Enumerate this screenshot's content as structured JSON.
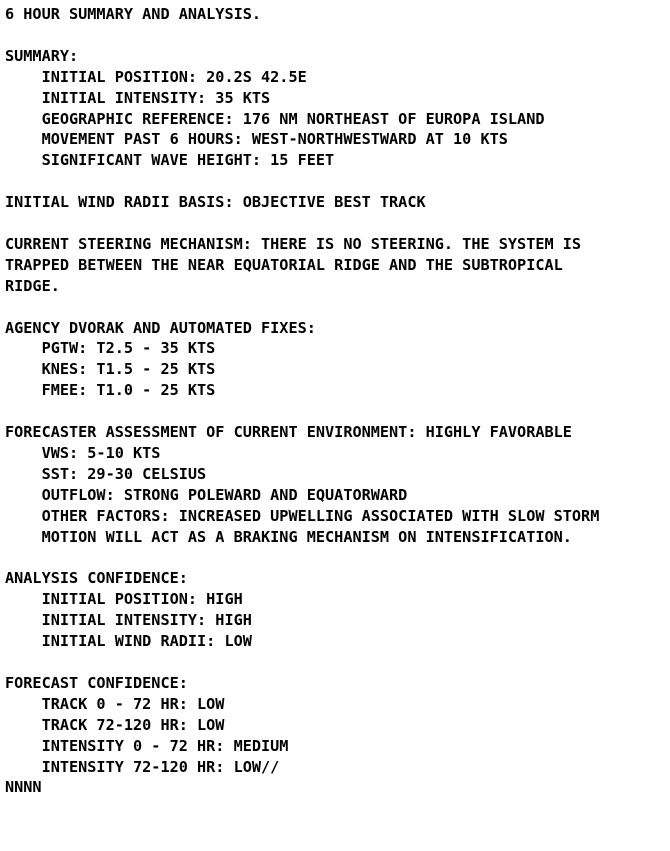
{
  "document": {
    "type": "plain-text-bulletin",
    "title": "6 HOUR SUMMARY AND ANALYSIS.",
    "terminator": "NNNN",
    "caret_after_line_index": 38,
    "colors": {
      "background": "#FFFFFF",
      "text": "#000000",
      "caret": "#000000"
    },
    "lines": [
      "6 HOUR SUMMARY AND ANALYSIS.",
      "",
      "SUMMARY:",
      "    INITIAL POSITION: 20.2S 42.5E",
      "    INITIAL INTENSITY: 35 KTS",
      "    GEOGRAPHIC REFERENCE: 176 NM NORTHEAST OF EUROPA ISLAND",
      "    MOVEMENT PAST 6 HOURS: WEST-NORTHWESTWARD AT 10 KTS",
      "    SIGNIFICANT WAVE HEIGHT: 15 FEET",
      "",
      "INITIAL WIND RADII BASIS: OBJECTIVE BEST TRACK",
      "",
      "CURRENT STEERING MECHANISM: THERE IS NO STEERING. THE SYSTEM IS",
      "TRAPPED BETWEEN THE NEAR EQUATORIAL RIDGE AND THE SUBTROPICAL",
      "RIDGE.",
      "",
      "AGENCY DVORAK AND AUTOMATED FIXES:",
      "    PGTW: T2.5 - 35 KTS",
      "    KNES: T1.5 - 25 KTS",
      "    FMEE: T1.0 - 25 KTS",
      "",
      "FORECASTER ASSESSMENT OF CURRENT ENVIRONMENT: HIGHLY FAVORABLE",
      "    VWS: 5-10 KTS",
      "    SST: 29-30 CELSIUS",
      "    OUTFLOW: STRONG POLEWARD AND EQUATORWARD",
      "    OTHER FACTORS: INCREASED UPWELLING ASSOCIATED WITH SLOW STORM",
      "    MOTION WILL ACT AS A BRAKING MECHANISM ON INTENSIFICATION.",
      "",
      "ANALYSIS CONFIDENCE:",
      "    INITIAL POSITION: HIGH",
      "    INITIAL INTENSITY: HIGH",
      "    INITIAL WIND RADII: LOW",
      "",
      "FORECAST CONFIDENCE:",
      "    TRACK 0 - 72 HR: LOW",
      "    TRACK 72-120 HR: LOW",
      "    INTENSITY 0 - 72 HR: MEDIUM",
      "    INTENSITY 72-120 HR: LOW//",
      "NNNN"
    ],
    "sections": {
      "summary": {
        "heading": "SUMMARY:",
        "fields": [
          {
            "label": "INITIAL POSITION",
            "value": "20.2S 42.5E"
          },
          {
            "label": "INITIAL INTENSITY",
            "value": "35 KTS"
          },
          {
            "label": "GEOGRAPHIC REFERENCE",
            "value": "176 NM NORTHEAST OF EUROPA ISLAND"
          },
          {
            "label": "MOVEMENT PAST 6 HOURS",
            "value": "WEST-NORTHWESTWARD AT 10 KTS"
          },
          {
            "label": "SIGNIFICANT WAVE HEIGHT",
            "value": "15 FEET"
          }
        ]
      },
      "initial_wind_radii_basis": {
        "label": "INITIAL WIND RADII BASIS",
        "value": "OBJECTIVE BEST TRACK"
      },
      "current_steering_mechanism": {
        "label": "CURRENT STEERING MECHANISM",
        "value": "THERE IS NO STEERING. THE SYSTEM IS TRAPPED BETWEEN THE NEAR EQUATORIAL RIDGE AND THE SUBTROPICAL RIDGE."
      },
      "agency_fixes": {
        "heading": "AGENCY DVORAK AND AUTOMATED FIXES:",
        "fixes": [
          {
            "agency": "PGTW",
            "t_number": "T2.5",
            "intensity": "35 KTS",
            "text": "PGTW: T2.5 - 35 KTS"
          },
          {
            "agency": "KNES",
            "t_number": "T1.5",
            "intensity": "25 KTS",
            "text": "KNES: T1.5 - 25 KTS"
          },
          {
            "agency": "FMEE",
            "t_number": "T1.0",
            "intensity": "25 KTS",
            "text": "FMEE: T1.0 - 25 KTS"
          }
        ]
      },
      "environment": {
        "heading": "FORECASTER ASSESSMENT OF CURRENT ENVIRONMENT: HIGHLY FAVORABLE",
        "assessment": "HIGHLY FAVORABLE",
        "fields": [
          {
            "label": "VWS",
            "value": "5-10 KTS"
          },
          {
            "label": "SST",
            "value": "29-30 CELSIUS"
          },
          {
            "label": "OUTFLOW",
            "value": "STRONG POLEWARD AND EQUATORWARD"
          },
          {
            "label": "OTHER FACTORS",
            "value": "INCREASED UPWELLING ASSOCIATED WITH SLOW STORM MOTION WILL ACT AS A BRAKING MECHANISM ON INTENSIFICATION."
          }
        ]
      },
      "analysis_confidence": {
        "heading": "ANALYSIS CONFIDENCE:",
        "fields": [
          {
            "label": "INITIAL POSITION",
            "value": "HIGH"
          },
          {
            "label": "INITIAL INTENSITY",
            "value": "HIGH"
          },
          {
            "label": "INITIAL WIND RADII",
            "value": "LOW"
          }
        ]
      },
      "forecast_confidence": {
        "heading": "FORECAST CONFIDENCE:",
        "fields": [
          {
            "label": "TRACK 0 - 72 HR",
            "value": "LOW"
          },
          {
            "label": "TRACK 72-120 HR",
            "value": "LOW"
          },
          {
            "label": "INTENSITY 0 - 72 HR",
            "value": "MEDIUM"
          },
          {
            "label": "INTENSITY 72-120 HR",
            "value": "LOW//"
          }
        ]
      }
    }
  }
}
